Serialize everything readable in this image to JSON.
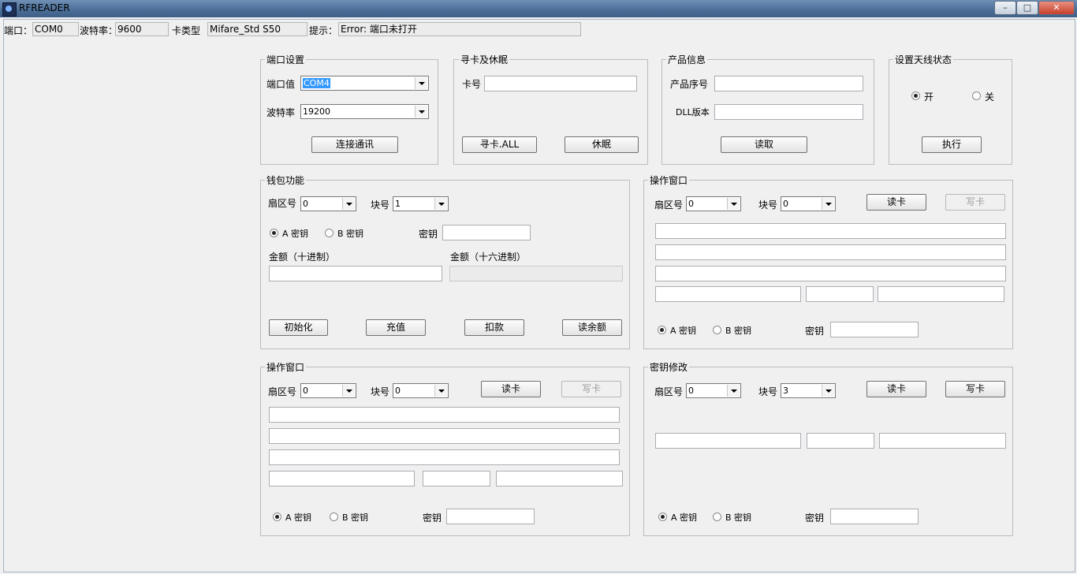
{
  "window": {
    "title": "RFREADER"
  },
  "status": {
    "port_label": "端口：",
    "port_value": "COM0",
    "baud_label": "波特率：",
    "baud_value": "9600",
    "card_label": "卡类型",
    "card_value": "Mifare_Std  S50",
    "hint_label": "提示：",
    "hint_value": "Error: 端口未打开"
  },
  "port_settings": {
    "title": "端口设置",
    "port_label": "端口值",
    "port_value": "COM4",
    "baud_label": "波特率",
    "baud_value": "19200",
    "connect_button": "连接通讯"
  },
  "seek_sleep": {
    "title": "寻卡及休眠",
    "card_label": "卡号",
    "card_value": "",
    "seek_button": "寻卡.ALL",
    "sleep_button": "休眠"
  },
  "product_info": {
    "title": "产品信息",
    "serial_label": "产品序号",
    "serial_value": "",
    "dll_label": "DLL版本",
    "dll_value": "",
    "read_button": "读取"
  },
  "antenna": {
    "title": "设置天线状态",
    "on_label": "开",
    "off_label": "关",
    "selected": "on",
    "exec_button": "执行"
  },
  "wallet": {
    "title": "钱包功能",
    "sector_label": "扇区号",
    "sector_value": "0",
    "block_label": "块号",
    "block_value": "1",
    "key_a_label": "A 密钥",
    "key_b_label": "B 密钥",
    "key_selected": "A",
    "key_label": "密钥",
    "key_value": "",
    "dec_label": "金额（十进制）",
    "hex_label": "金额（十六进制）",
    "dec_value": "",
    "hex_value": "",
    "init_button": "初始化",
    "charge_button": "充值",
    "deduct_button": "扣款",
    "balance_button": "读余额"
  },
  "op_window_1": {
    "title": "操作窗口",
    "sector_label": "扇区号",
    "sector_value": "0",
    "block_label": "块号",
    "block_value": "0",
    "read_button": "读卡",
    "write_button": "写卡",
    "key_a_label": "A 密钥",
    "key_b_label": "B 密钥",
    "key_selected": "A",
    "key_label": "密钥",
    "key_value": ""
  },
  "op_window_2": {
    "title": "操作窗口",
    "sector_label": "扇区号",
    "sector_value": "0",
    "block_label": "块号",
    "block_value": "0",
    "read_button": "读卡",
    "write_button": "写卡",
    "key_a_label": "A 密钥",
    "key_b_label": "B 密钥",
    "key_selected": "A",
    "key_label": "密钥",
    "key_value": ""
  },
  "key_change": {
    "title": "密钥修改",
    "sector_label": "扇区号",
    "sector_value": "0",
    "block_label": "块号",
    "block_value": "3",
    "read_button": "读卡",
    "write_button": "写卡",
    "key_a_label": "A 密钥",
    "key_b_label": "B 密钥",
    "key_selected": "A",
    "key_label": "密钥",
    "key_value": ""
  }
}
